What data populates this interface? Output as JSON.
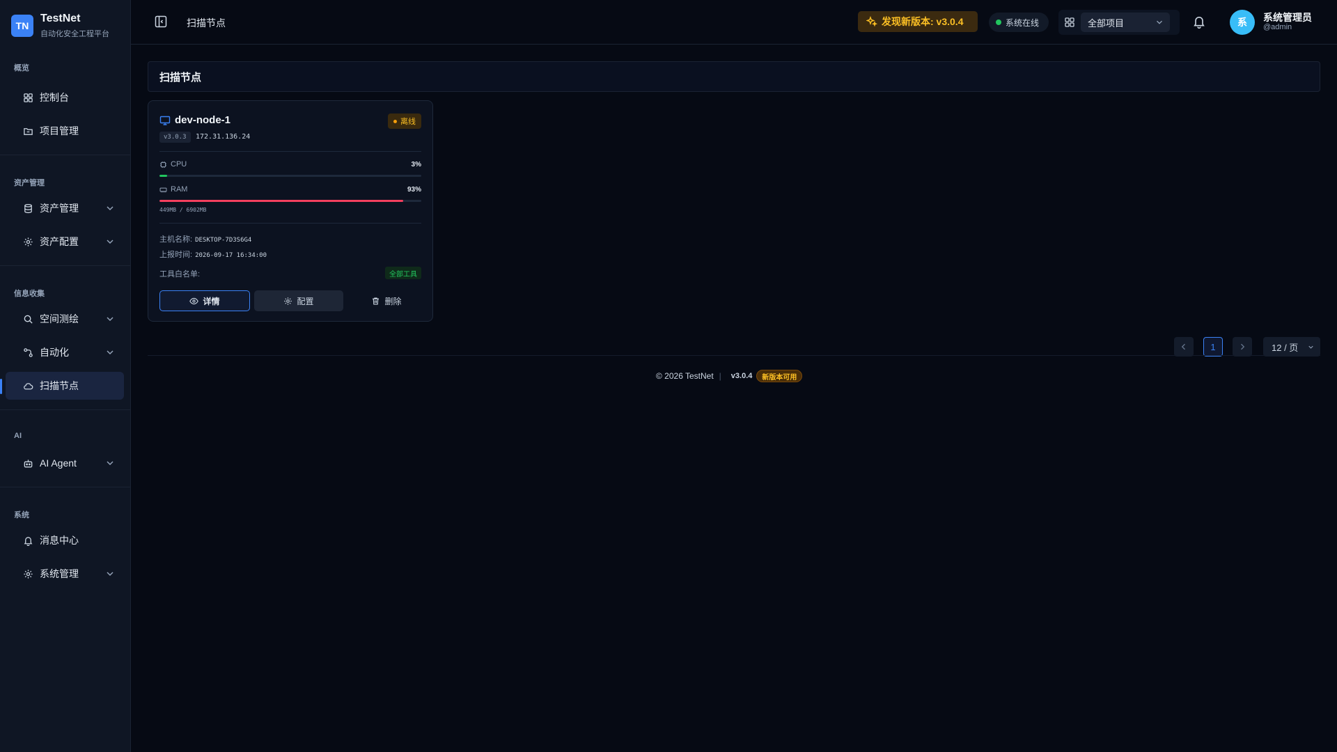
{
  "brand": {
    "logo": "TN",
    "name": "TestNet",
    "subtitle": "自动化安全工程平台"
  },
  "sidebar": {
    "sections": [
      {
        "label": "概览"
      },
      {
        "label": "资产管理"
      },
      {
        "label": "信息收集"
      },
      {
        "label": "AI"
      },
      {
        "label": "系统"
      }
    ],
    "items": [
      {
        "label": "控制台",
        "icon": "dashboard-icon"
      },
      {
        "label": "项目管理",
        "icon": "folder-icon"
      },
      {
        "label": "资产管理",
        "icon": "database-icon"
      },
      {
        "label": "资产配置",
        "icon": "gear-icon"
      },
      {
        "label": "空间测绘",
        "icon": "search-icon"
      },
      {
        "label": "自动化",
        "icon": "workflow-icon"
      },
      {
        "label": "扫描节点",
        "icon": "cloud-icon",
        "active": true
      },
      {
        "label": "AI Agent",
        "icon": "bot-icon"
      },
      {
        "label": "消息中心",
        "icon": "bell-icon"
      },
      {
        "label": "系统管理",
        "icon": "gear-icon"
      }
    ]
  },
  "topbar": {
    "breadcrumb": "扫描节点",
    "update_notice": "发现新版本: v3.0.4",
    "status": "系统在线",
    "project_select": "全部项目",
    "user": {
      "avatar": "系",
      "name": "系统管理员",
      "handle": "@admin"
    }
  },
  "page": {
    "title": "扫描节点"
  },
  "node": {
    "name": "dev-node-1",
    "status": "离线",
    "version": "v3.0.3",
    "ip": "172.31.136.24",
    "cpu": {
      "label": "CPU",
      "value": "3%",
      "percent": 3
    },
    "ram": {
      "label": "RAM",
      "value": "93%",
      "percent": 93,
      "detail": "449MB / 6902MB"
    },
    "hostname_label": "主机名称:",
    "hostname": "DESKTOP-7D3S6G4",
    "report_label": "上报时间:",
    "report_time": "2026-09-17 16:34:00",
    "whitelist_label": "工具白名单:",
    "whitelist_value": "全部工具",
    "buttons": {
      "detail": "详情",
      "config": "配置",
      "delete": "删除"
    }
  },
  "pagination": {
    "current": "1",
    "page_size": "12 / 页"
  },
  "footer": {
    "copyright": "© 2026 TestNet",
    "separator": "|",
    "version": "v3.0.4",
    "badge": "新版本可用"
  },
  "colors": {
    "accent": "#3b82f6",
    "warning": "#fbbf24",
    "success": "#22c55e",
    "danger": "#f43f5e"
  }
}
